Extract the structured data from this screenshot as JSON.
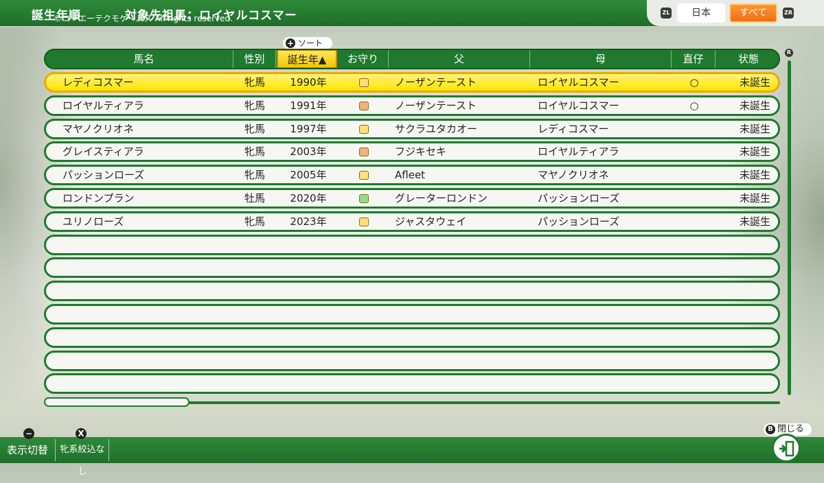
{
  "top": {
    "sort_mode": "誕生年順",
    "target": "対象先祖馬：ロイヤルコスマー",
    "copyright": "©コーエーテクモゲームス All rights reserved.",
    "zl": "ZL",
    "zr": "ZR",
    "tabs": [
      "日本",
      "すべて"
    ],
    "active_tab": "すべて"
  },
  "sort_tag": {
    "button": "+",
    "label": "ソート"
  },
  "table": {
    "headers": [
      "馬名",
      "性別",
      "誕生年▲",
      "お守り",
      "父",
      "母",
      "直仔",
      "状態"
    ],
    "sorted_column": "誕生年",
    "rows": [
      {
        "name": "レディコスマー",
        "sex": "牝馬",
        "year": "1990年",
        "amulet": "yellow",
        "sire": "ノーザンテースト",
        "dam": "ロイヤルコスマー",
        "direct": "○",
        "status": "未誕生",
        "selected": true
      },
      {
        "name": "ロイヤルティアラ",
        "sex": "牝馬",
        "year": "1991年",
        "amulet": "orange",
        "sire": "ノーザンテースト",
        "dam": "ロイヤルコスマー",
        "direct": "○",
        "status": "未誕生",
        "selected": false
      },
      {
        "name": "マヤノクリオネ",
        "sex": "牝馬",
        "year": "1997年",
        "amulet": "yellow",
        "sire": "サクラユタカオー",
        "dam": "レディコスマー",
        "direct": "",
        "status": "未誕生",
        "selected": false
      },
      {
        "name": "グレイスティアラ",
        "sex": "牝馬",
        "year": "2003年",
        "amulet": "orange",
        "sire": "フジキセキ",
        "dam": "ロイヤルティアラ",
        "direct": "",
        "status": "未誕生",
        "selected": false
      },
      {
        "name": "パッションローズ",
        "sex": "牝馬",
        "year": "2005年",
        "amulet": "yellow",
        "sire": "Afleet",
        "dam": "マヤノクリオネ",
        "direct": "",
        "status": "未誕生",
        "selected": false
      },
      {
        "name": "ロンドンプラン",
        "sex": "牡馬",
        "year": "2020年",
        "amulet": "green",
        "sire": "グレーターロンドン",
        "dam": "パッションローズ",
        "direct": "",
        "status": "未誕生",
        "selected": false
      },
      {
        "name": "ユリノローズ",
        "sex": "牝馬",
        "year": "2023年",
        "amulet": "yellow",
        "sire": "ジャスタウェイ",
        "dam": "パッションローズ",
        "direct": "",
        "status": "未誕生",
        "selected": false
      }
    ],
    "empty_rows": 7
  },
  "amulet_colors": {
    "yellow": "#ffe07a",
    "orange": "#f2b27a",
    "green": "#8fe08a"
  },
  "bottom": {
    "minus": "−",
    "x": "X",
    "display_toggle": "表示切替",
    "filter": "牝系絞込なし",
    "b": "B",
    "close": "閉じる"
  },
  "scroll": {
    "r": "R"
  }
}
